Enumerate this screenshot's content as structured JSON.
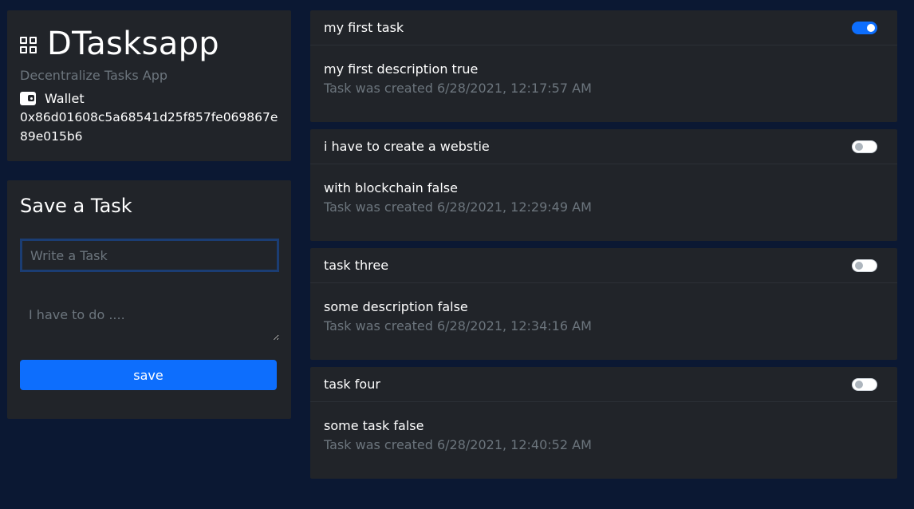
{
  "brand": {
    "title": "DTasksapp",
    "subtitle": "Decentralize Tasks App",
    "icon": "grid-icon",
    "wallet_label": "Wallet",
    "wallet_icon": "wallet-icon",
    "wallet_address": "0x86d01608c5a68541d25f857fe069867e89e015b6"
  },
  "form": {
    "title": "Save a Task",
    "task_placeholder": "Write a Task",
    "task_value": "",
    "description_placeholder": "I have to do ....",
    "description_value": "",
    "save_label": "save"
  },
  "tasks": [
    {
      "title": "my first task",
      "description": "my first description true",
      "created": "Task was created 6/28/2021, 12:17:57 AM",
      "done": true
    },
    {
      "title": "i have to create a webstie",
      "description": "with blockchain false",
      "created": "Task was created 6/28/2021, 12:29:49 AM",
      "done": false
    },
    {
      "title": "task three",
      "description": "some description false",
      "created": "Task was created 6/28/2021, 12:34:16 AM",
      "done": false
    },
    {
      "title": "task four",
      "description": "some task false",
      "created": "Task was created 6/28/2021, 12:40:52 AM",
      "done": false
    }
  ],
  "colors": {
    "background": "#0b1833",
    "card": "#212429",
    "accent": "#0d6efd",
    "muted_text": "#6c757d"
  }
}
